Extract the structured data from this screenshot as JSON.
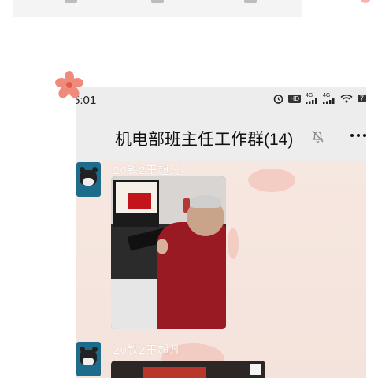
{
  "status_bar": {
    "time": "5:01",
    "icons": [
      "alarm-icon",
      "hd-voice-icon",
      "signal-4g-icon",
      "signal-4g-icon",
      "wifi-icon",
      "battery-icon"
    ],
    "hd_label": "HD",
    "network_1": "4G",
    "network_2": "4G",
    "battery_partial": "7"
  },
  "chat": {
    "title": "机电部班主任工作群(14)",
    "muted_icon": "bell-off-icon",
    "more_icon": "more-dots-icon"
  },
  "messages": [
    {
      "sender": "20铁2王超凡",
      "type": "image",
      "avatar_icon": "cartoon-bear-avatar"
    },
    {
      "sender": "20铁2王超凡",
      "type": "image",
      "avatar_icon": "cartoon-bear-avatar"
    }
  ],
  "colors": {
    "header_bg": "#ededed",
    "chat_bg": "#f6e7e0",
    "accent_red": "#c2141a"
  }
}
